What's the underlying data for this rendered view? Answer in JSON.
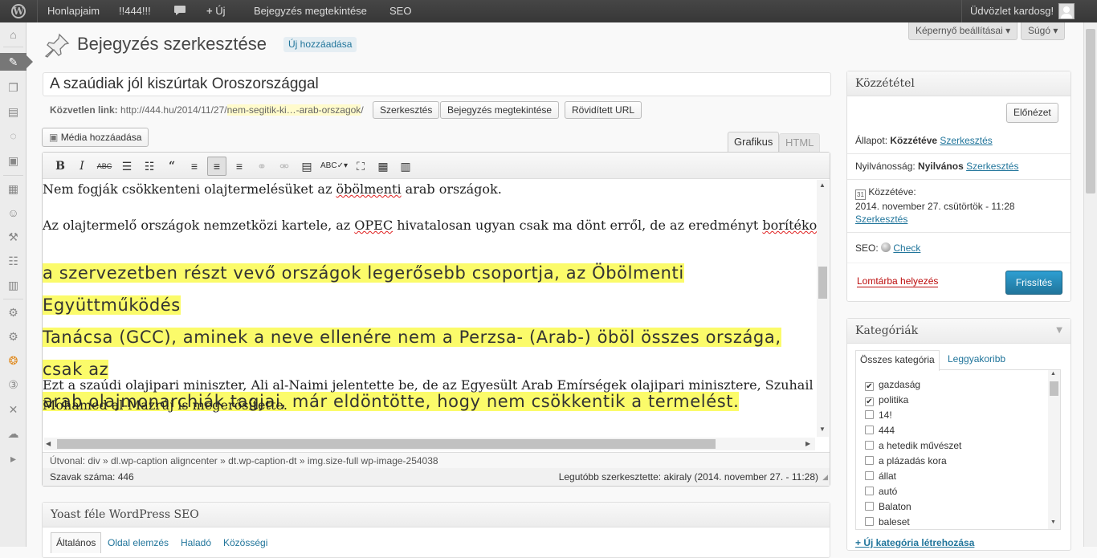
{
  "admin_bar": {
    "site_name": "Honlapjaim",
    "update_label": "!!444!!!",
    "new_label": "Új",
    "view_post_label": "Bejegyzés megtekintése",
    "seo_label": "SEO",
    "greeting": "Üdvözlet kardosg!"
  },
  "screen": {
    "options_label": "Képernyő beállításai",
    "help_label": "Súgó"
  },
  "page": {
    "heading": "Bejegyzés szerkesztése",
    "add_new": "Új hozzáadása",
    "post_title": "A szaúdiak jól kiszúrtak Oroszországgal"
  },
  "permalink": {
    "label": "Közvetlen link:",
    "base": "http://444.hu/2014/11/27/",
    "slug": "nem-segitik-ki…-arab-orszagok",
    "tail": "/",
    "edit_button": "Szerkesztés",
    "view_button": "Bejegyzés megtekintése",
    "shortlink_button": "Rövidített URL"
  },
  "editor": {
    "add_media": "Média hozzáadása",
    "tab_visual": "Grafikus",
    "tab_html": "HTML",
    "para1": "Nem fogják csökkenteni olajtermelésüket az öbölmenti arab országok.",
    "para2": "Az olajtermelő országok nemzetközi kartele, az OPEC hivatalosan ugyan csak ma dönt erről, de az eredményt borítékolni lehet:",
    "quote_line1": "a szervezetben részt vevő országok legerősebb csoportja, az Öbölmenti Együttműködés ",
    "quote_line2": "Tanácsa (GCC), aminek a neve ellenére nem a Perzsa- (Arab-) öböl összes országa, csak az",
    "quote_line3": "arab olajmonarchiák tagjai, már eldöntötte, hogy nem csökkentik a termelést.",
    "para3_line1": "Ezt a szaúdi olajipari miniszter, Ali al-Naimi jelentette be, de az Egyesült Arab Emírségek olajipari minisztere, Szuhail bin",
    "para3_line2": "Mohamed al-Mazrúj is megerősítette.",
    "path": "Útvonal: div » dl.wp-caption aligncenter » dt.wp-caption-dt » img.size-full wp-image-254038",
    "word_count": "Szavak száma: 446",
    "last_edited": "Legutóbb szerkesztette: akiraly (2014. november 27. - 11:28)"
  },
  "seo_box": {
    "title": "Yoast féle WordPress SEO",
    "tabs": [
      "Általános",
      "Oldal elemzés",
      "Haladó",
      "Közösségi"
    ]
  },
  "publish": {
    "title": "Közzététel",
    "preview": "Előnézet",
    "status_label": "Állapot:",
    "status_value": "Közzétéve",
    "visibility_label": "Nyilvánosság:",
    "visibility_value": "Nyilvános",
    "edit_link": "Szerkesztés",
    "published_label": "Közzétéve:",
    "published_date": "2014. november 27. csütörtök - 11:28",
    "seo_label": "SEO:",
    "seo_check": "Check",
    "trash": "Lomtárba helyezés",
    "update": "Frissítés"
  },
  "categories": {
    "title": "Kategóriák",
    "tab_all": "Összes kategória",
    "tab_popular": "Leggyakoribb",
    "items": [
      {
        "label": "gazdaság",
        "checked": true
      },
      {
        "label": "politika",
        "checked": true
      },
      {
        "label": "14!",
        "checked": false
      },
      {
        "label": "444",
        "checked": false
      },
      {
        "label": "a hetedik művészet",
        "checked": false
      },
      {
        "label": "a plázadás kora",
        "checked": false
      },
      {
        "label": "állat",
        "checked": false
      },
      {
        "label": "autó",
        "checked": false
      },
      {
        "label": "Balaton",
        "checked": false
      },
      {
        "label": "baleset",
        "checked": false
      }
    ],
    "add_new": "+ Új kategória létrehozása"
  },
  "colors": {
    "highlight": "#fbfb6a",
    "primary_button": "#2a8bbd",
    "link": "#21759b",
    "trash": "#bc0b0b"
  }
}
